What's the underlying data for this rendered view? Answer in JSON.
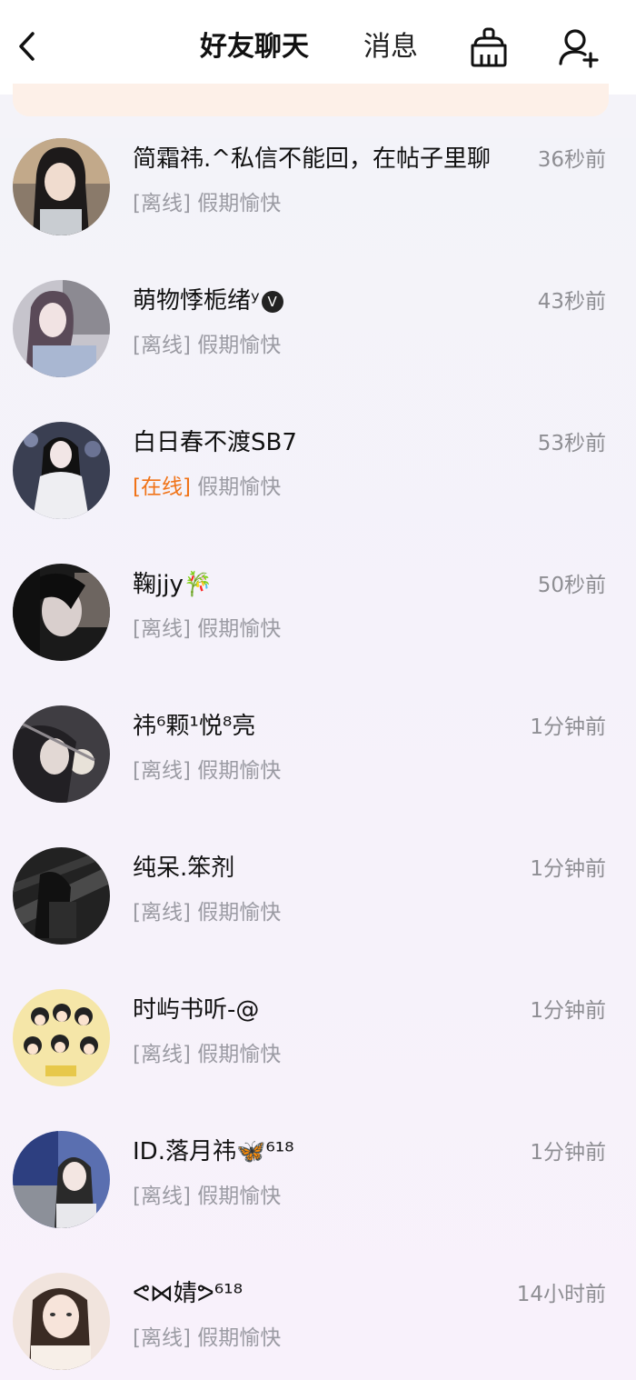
{
  "header": {
    "tabs": [
      {
        "label": "好友聊天",
        "active": true
      },
      {
        "label": "消息",
        "active": false
      }
    ],
    "accent_color": "#f07318"
  },
  "chats": [
    {
      "name": "简霜祎.^私信不能回，在帖子里聊",
      "time": "36秒前",
      "status": "[离线]",
      "last_message": "假期愉快",
      "online": false
    },
    {
      "name": "萌物悸栀绪ʸ",
      "badge": "V",
      "time": "43秒前",
      "status": "[离线]",
      "last_message": "假期愉快",
      "online": false
    },
    {
      "name": "白日春不渡SB7",
      "time": "53秒前",
      "status": "[在线]",
      "last_message": "假期愉快",
      "online": true
    },
    {
      "name": "鞠jjy🎋",
      "time": "50秒前",
      "status": "[离线]",
      "last_message": "假期愉快",
      "online": false
    },
    {
      "name": "祎⁶颗¹悦⁸亮",
      "time": "1分钟前",
      "status": "[离线]",
      "last_message": "假期愉快",
      "online": false
    },
    {
      "name": "纯呆.笨剂",
      "time": "1分钟前",
      "status": "[离线]",
      "last_message": "假期愉快",
      "online": false
    },
    {
      "name": "时屿书听-@",
      "time": "1分钟前",
      "status": "[离线]",
      "last_message": "假期愉快",
      "online": false
    },
    {
      "name": "ID.落月祎🦋⁶¹⁸",
      "time": "1分钟前",
      "status": "[离线]",
      "last_message": "假期愉快",
      "online": false
    },
    {
      "name": "ᕙ⋈婧ᕗ⁶¹⁸",
      "time": "14小时前",
      "status": "[离线]",
      "last_message": "假期愉快",
      "online": false
    }
  ]
}
